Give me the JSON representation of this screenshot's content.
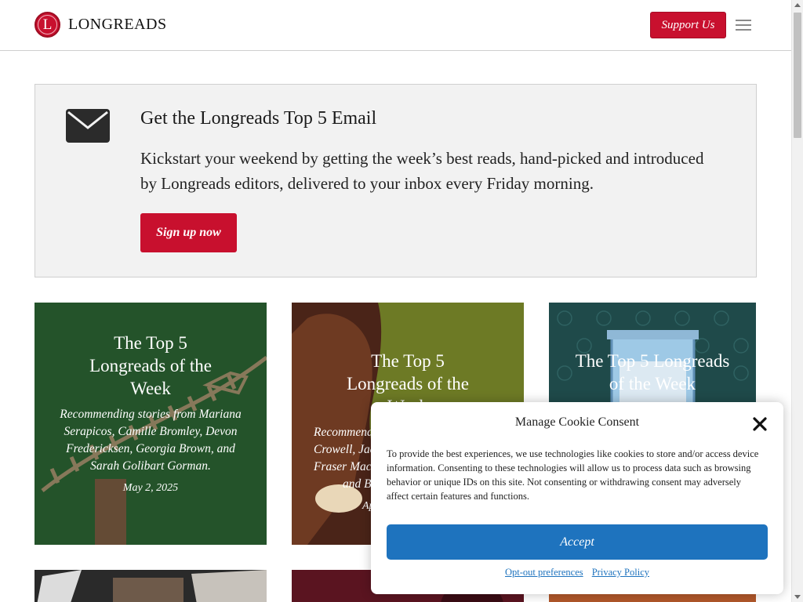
{
  "header": {
    "logo_letter": "L",
    "logo_text": "LONGREADS",
    "support_label": "Support Us",
    "menu_icon": "hamburger-menu-icon"
  },
  "newsletter": {
    "icon": "envelope-icon",
    "title": "Get the Longreads Top 5 Email",
    "body": "Kickstart your weekend by getting the week’s best reads, hand-picked and introduced by Longreads editors, delivered to your inbox every Friday morning.",
    "button_label": "Sign up now"
  },
  "cards": [
    {
      "title": "The Top 5 Longreads of the Week",
      "description": "Recommending stories from Mariana Serapicos, Camille Bromley, Devon Fredericksen, Georgia Brown, and Sarah Golibart Gorman.",
      "date": "May 2, 2025"
    },
    {
      "title": "The Top 5 Longreads of the Week",
      "description_lines": [
        "Recommend",
        "Crowell, Jac",
        "Fraser Mac",
        "and B"
      ],
      "date": "Ap"
    },
    {
      "title": "The Top 5 Longreads of the Week"
    }
  ],
  "cookie": {
    "title": "Manage Cookie Consent",
    "close_icon": "close-icon",
    "text": "To provide the best experiences, we use technologies like cookies to store and/or access device information. Consenting to these technologies will allow us to process data such as browsing behavior or unique IDs on this site. Not consenting or withdrawing consent may adversely affect certain features and functions.",
    "accept_label": "Accept",
    "optout_label": "Opt-out preferences",
    "privacy_label": "Privacy Policy"
  },
  "colors": {
    "brand_red": "#c8102e",
    "accept_blue": "#1e73be"
  }
}
